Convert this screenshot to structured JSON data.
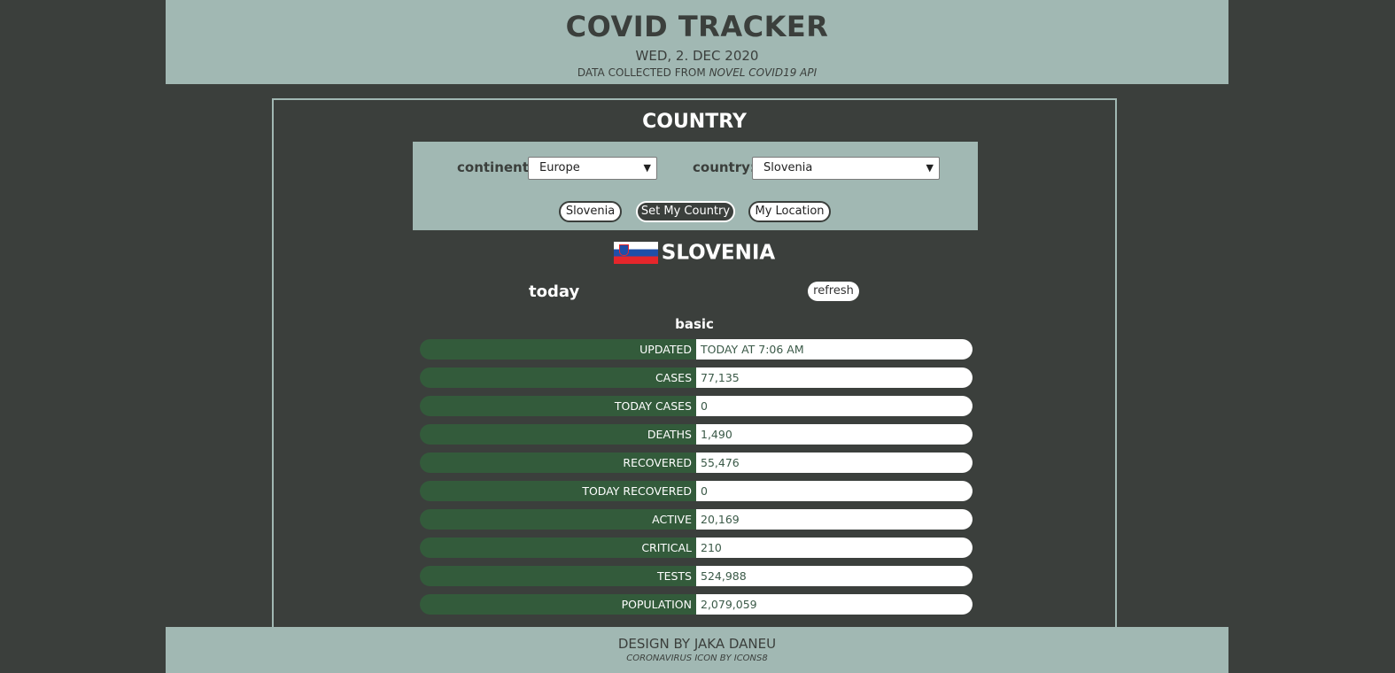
{
  "header": {
    "title": "COVID TRACKER",
    "date": "WED, 2. DEC 2020",
    "source_prefix": "DATA COLLECTED FROM ",
    "source_name": "NOVEL COVID19 API"
  },
  "panel": {
    "title": "COUNTRY",
    "continent_label": "continent:",
    "continent_value": "Europe",
    "country_label": "country:",
    "country_value": "Slovenia",
    "buttons": [
      "Slovenia",
      "Set My Country",
      "My Location"
    ]
  },
  "country": {
    "name": "SLOVENIA",
    "flag": "slovenia-flag"
  },
  "today_label": "today",
  "refresh_label": "refresh",
  "section_label": "basic",
  "stats": [
    {
      "label": "UPDATED",
      "value": "TODAY AT 7:06 AM"
    },
    {
      "label": "CASES",
      "value": "77,135"
    },
    {
      "label": "TODAY CASES",
      "value": "0"
    },
    {
      "label": "DEATHS",
      "value": "1,490"
    },
    {
      "label": "RECOVERED",
      "value": "55,476"
    },
    {
      "label": "TODAY RECOVERED",
      "value": "0"
    },
    {
      "label": "ACTIVE",
      "value": "20,169"
    },
    {
      "label": "CRITICAL",
      "value": "210"
    },
    {
      "label": "TESTS",
      "value": "524,988"
    },
    {
      "label": "POPULATION",
      "value": "2,079,059"
    }
  ],
  "footer": {
    "design": "DESIGN BY JAKA DANEU",
    "icon_credit": "CORONAVIRUS ICON BY ICONS8"
  },
  "colors": {
    "background": "#3b3f3c",
    "accent": "#a1b8b3",
    "label_green": "#335b3b"
  }
}
